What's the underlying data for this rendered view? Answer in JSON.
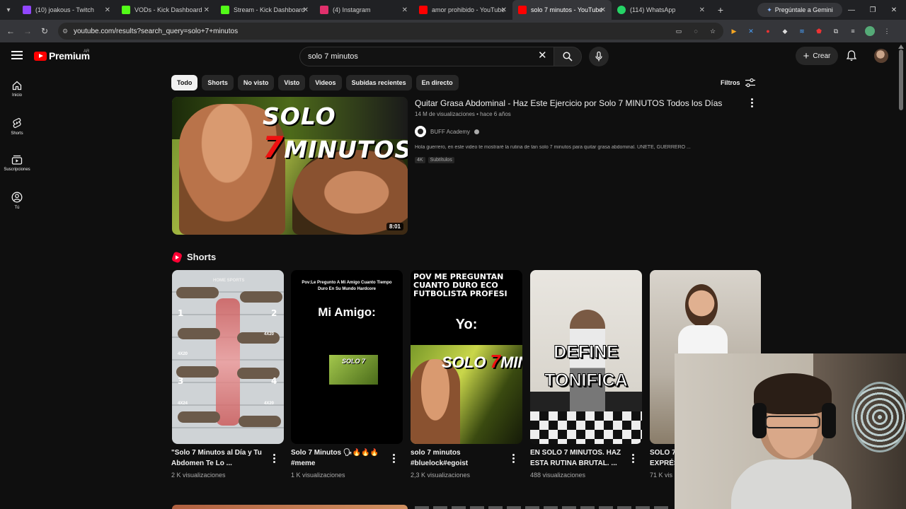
{
  "browser": {
    "tabs": [
      {
        "label": "(10) joakous - Twitch",
        "fav_color": "#9146ff"
      },
      {
        "label": "VODs - Kick Dashboard",
        "fav_color": "#53fc18"
      },
      {
        "label": "Stream - Kick Dashboard",
        "fav_color": "#53fc18"
      },
      {
        "label": "(4) Instagram",
        "fav_color": "#e1306c"
      },
      {
        "label": "amor prohibido - YouTube",
        "fav_color": "#ff0000"
      },
      {
        "label": "solo 7 minutos - YouTube",
        "fav_color": "#ff0000"
      },
      {
        "label": "(114) WhatsApp",
        "fav_color": "#25d366"
      }
    ],
    "gemini_label": "Pregúntale a Gemini",
    "url": "youtube.com/results?search_query=solo+7+minutos"
  },
  "yt": {
    "logo_text": "Premium",
    "logo_region": "AR",
    "search_value": "solo 7 minutos",
    "create_label": "Crear",
    "guide": [
      {
        "label": "Inicio",
        "icon": "home-icon"
      },
      {
        "label": "Shorts",
        "icon": "shorts-icon"
      },
      {
        "label": "Suscripciones",
        "icon": "subscriptions-icon"
      },
      {
        "label": "Tú",
        "icon": "you-icon"
      }
    ],
    "chips": [
      "Todo",
      "Shorts",
      "No visto",
      "Visto",
      "Videos",
      "Subidas recientes",
      "En directo"
    ],
    "filters_label": "Filtros"
  },
  "main_video": {
    "thumb_text_a": "SOLO",
    "thumb_text_b": "7",
    "thumb_text_c": "MINUTOS",
    "duration": "8:01",
    "title": "Quitar Grasa Abdominal - Haz Este Ejercicio por Solo 7 MINUTOS Todos los Días",
    "meta": "14 M de visualizaciones • hace 6 años",
    "channel": "BUFF Academy",
    "description": "Hola guerrero, en este video te mostraré la rutina de tan solo 7 minutos para quitar grasa abdominal. ÚNETE, GUERRERO ...",
    "badges": [
      "4K",
      "Subtítulos"
    ]
  },
  "shorts": {
    "heading": "Shorts",
    "items": [
      {
        "title": "\"Solo 7 Minutos al Día y Tu Abdomen Te Lo ...",
        "views": "2 K visualizaciones",
        "thumb_text": "HOME SPORTS"
      },
      {
        "title": "Solo 7 Minutos 🗣🔥🔥🔥 #meme",
        "views": "1 K visualizaciones",
        "thumb_caption": "Pov:Le Pregunto A Mi Amigo Cuanto Tiempo Duro En Su Mundo Hardcore",
        "thumb_big": "Mi Amigo:",
        "thumb_mini": "SOLO 7"
      },
      {
        "title": "solo 7 minutos #bluelock#egoist",
        "views": "2,3 K visualizaciones",
        "thumb_caption": "POV ME PREGUNTAN CUANTO DURO ECO FUTBOLISTA PROFESI",
        "thumb_big": "Yo:",
        "thumb_mini_a": "SOLO",
        "thumb_mini_b": "7",
        "thumb_mini_c": "MIN"
      },
      {
        "title": "EN SOLO 7 MINUTOS. HAZ ESTA RUTINA BRUTAL. ...",
        "views": "488 visualizaciones",
        "thumb_line1": "DEFINE",
        "thumb_line2": "TONIFICA"
      },
      {
        "title": "SOLO 7",
        "title_line2": "EXPRÉS",
        "views": "71 K vis"
      }
    ]
  },
  "thumb_numbers": {
    "n1": "1",
    "n2": "2",
    "n3": "3",
    "n4": "4",
    "r1": "4X20",
    "r2": "4X20",
    "r3": "4X24",
    "r4": "4X20"
  }
}
